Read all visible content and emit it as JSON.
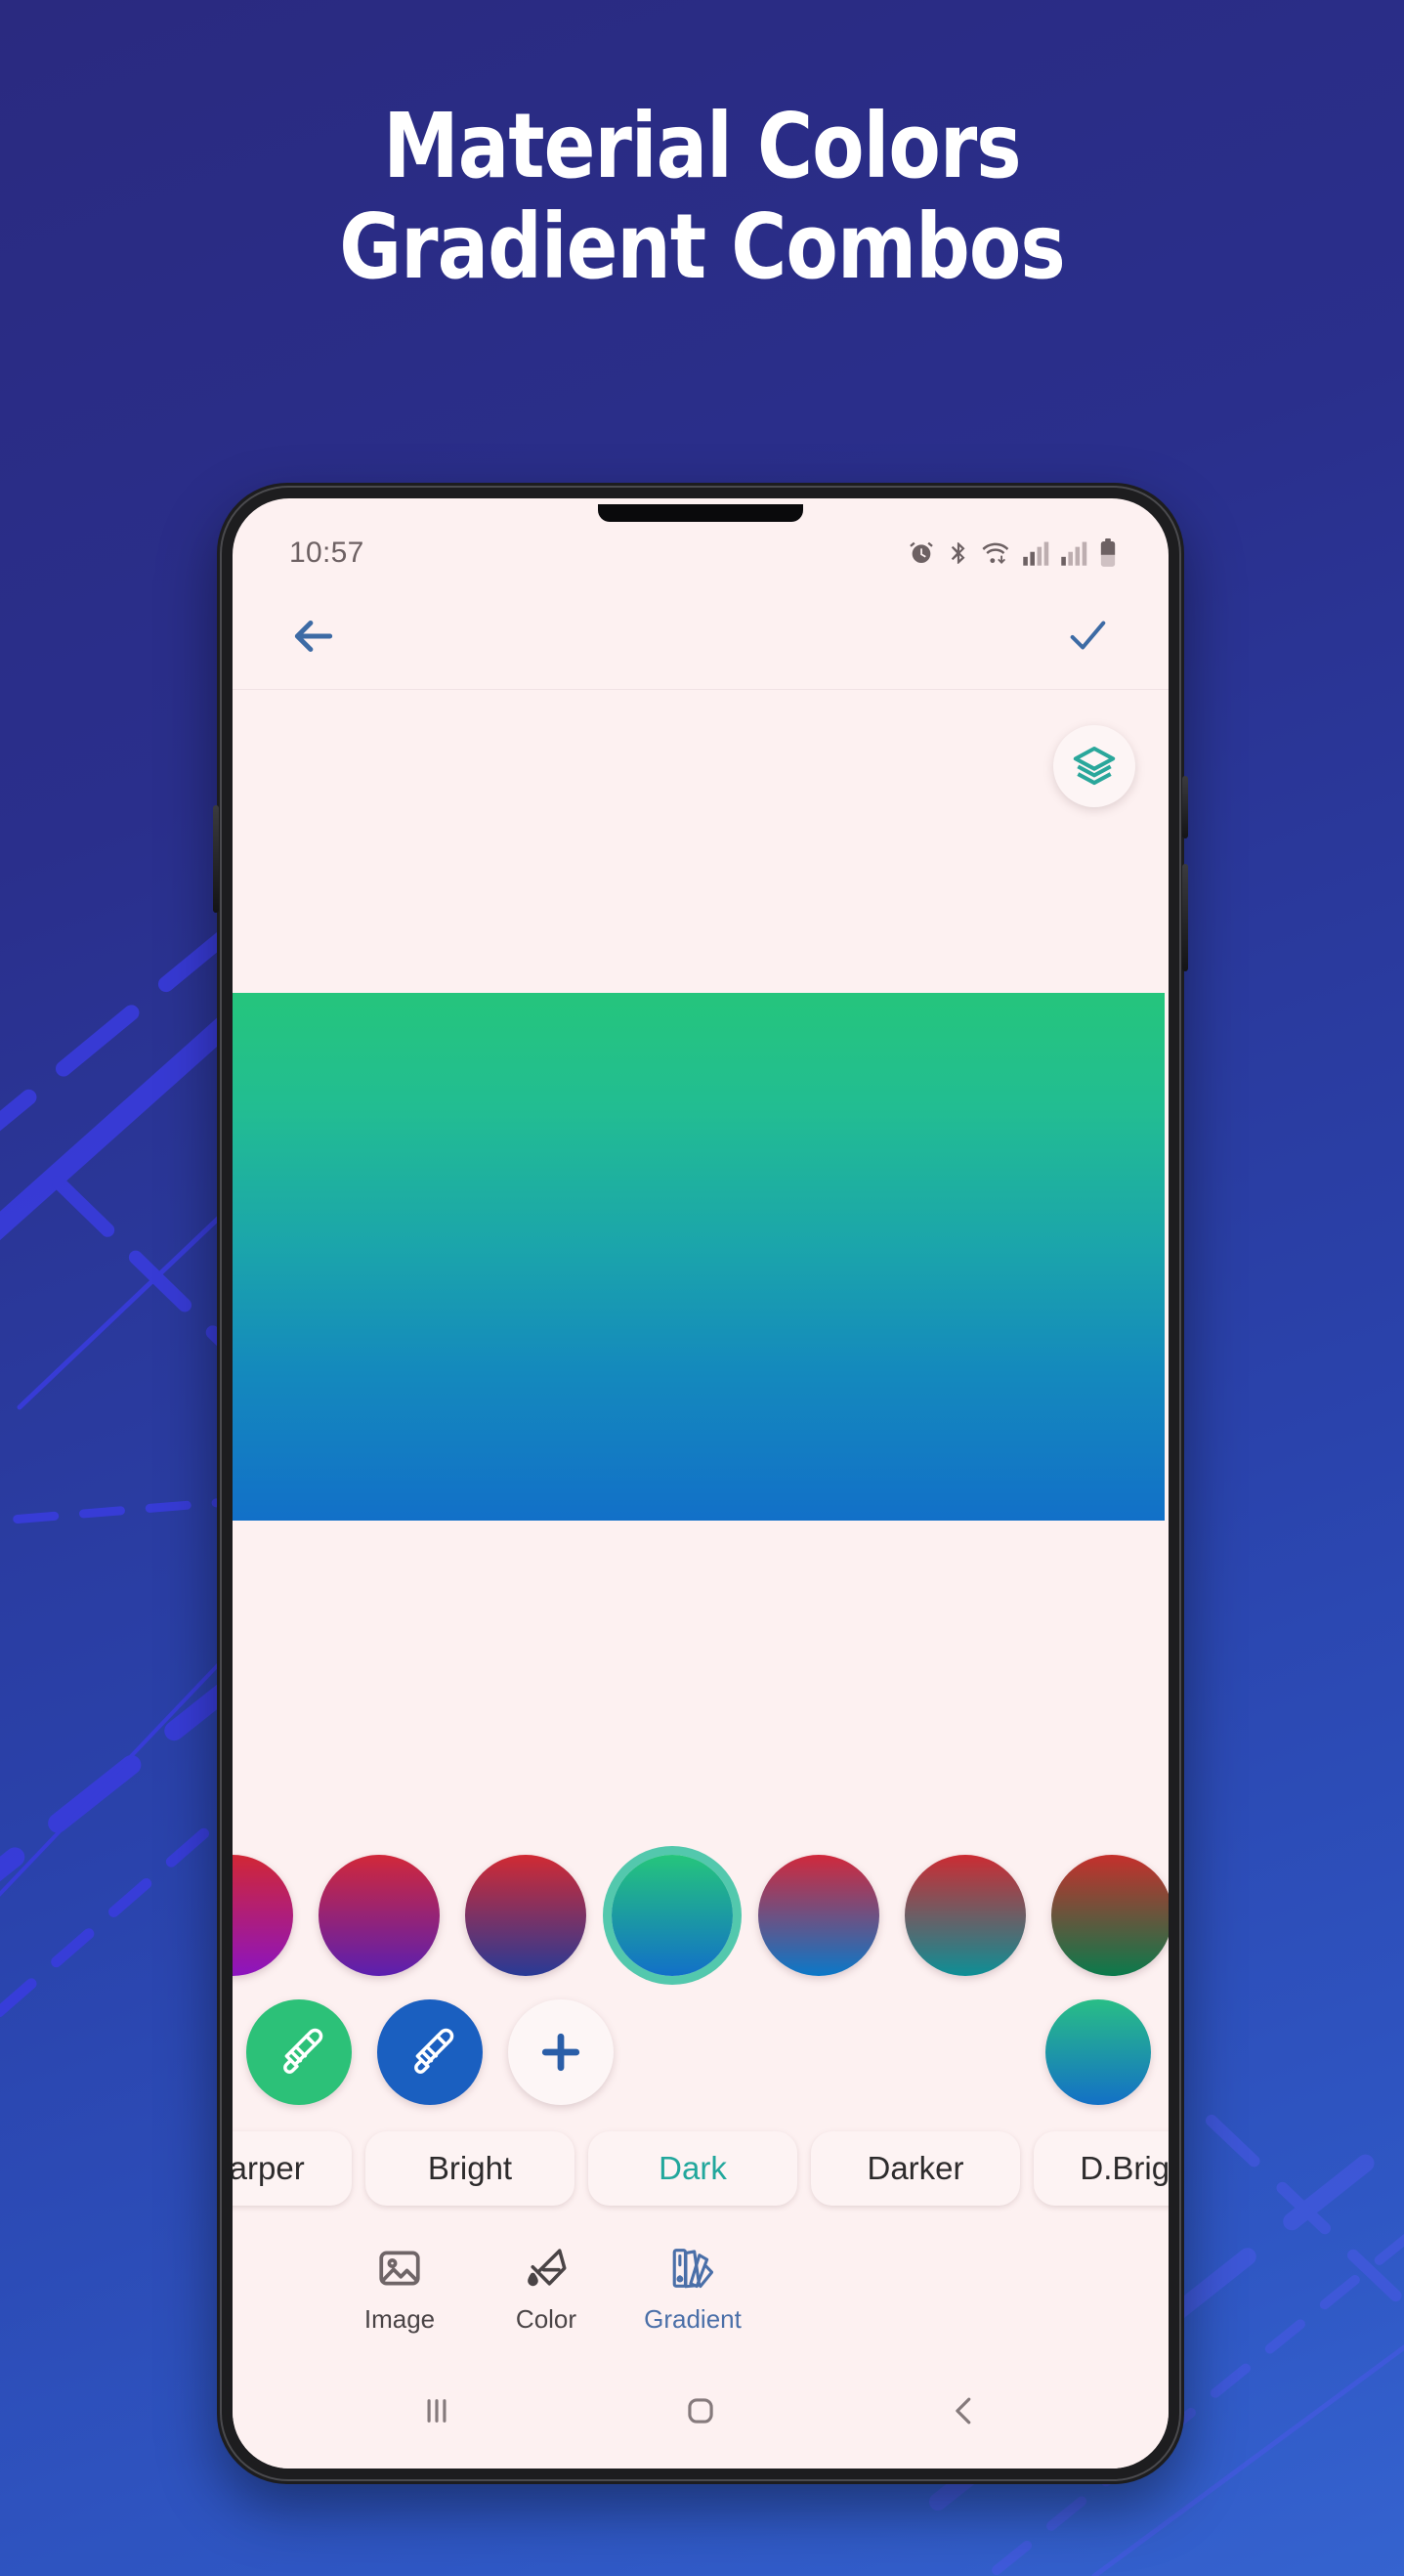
{
  "promo": {
    "headline_line1": "Material Colors",
    "headline_line2": "Gradient Combos",
    "background_color": "#2a2f8c",
    "accent_line_color": "#3a3ce0"
  },
  "phone": {
    "statusbar": {
      "time": "10:57",
      "icons": [
        "alarm-icon",
        "bluetooth-icon",
        "wifi-icon",
        "signal-icon-1",
        "signal-icon-2",
        "battery-icon"
      ]
    },
    "toolbar": {
      "back_label": "back-arrow",
      "confirm_label": "check",
      "icon_color": "#3d6ba5"
    },
    "canvas": {
      "layers_button_label": "layers",
      "layers_icon_color": "#2aa79b",
      "gradient_preview": {
        "start_color": "#25c57c",
        "end_color": "#1270c8"
      }
    },
    "swatches": [
      {
        "name": "red-purple-1",
        "start": "#d12735",
        "end": "#8c14c0"
      },
      {
        "name": "red-purple-2",
        "start": "#d1283a",
        "end": "#5b1fb0"
      },
      {
        "name": "red-navy",
        "start": "#d12a33",
        "end": "#283a96"
      },
      {
        "name": "green-blue",
        "start": "#25c57c",
        "end": "#1270c8",
        "selected": true
      },
      {
        "name": "red-blue",
        "start": "#d1293c",
        "end": "#0b78c8"
      },
      {
        "name": "red-teal",
        "start": "#cc2c33",
        "end": "#0d8f96"
      },
      {
        "name": "red-darkgreen",
        "start": "#c5302c",
        "end": "#0b7a4c"
      }
    ],
    "tools": [
      {
        "name": "eyedropper-start",
        "color": "#2cc178",
        "icon": "eyedropper-icon"
      },
      {
        "name": "eyedropper-end",
        "color": "#1a5fc0",
        "icon": "eyedropper-icon"
      },
      {
        "name": "add-color",
        "color": "#fdf6f6",
        "icon": "plus-icon"
      }
    ],
    "tool_preview": {
      "name": "gradient-preview-circle",
      "start": "#29be86",
      "end": "#1370c6"
    },
    "chips": [
      {
        "label": "Sharper",
        "active": false
      },
      {
        "label": "Bright",
        "active": false
      },
      {
        "label": "Dark",
        "active": true
      },
      {
        "label": "Darker",
        "active": false
      },
      {
        "label": "D.Bright",
        "active": false
      }
    ],
    "chip_active_color": "#22a79c",
    "bottomnav": [
      {
        "label": "Image",
        "icon": "image-icon",
        "active": false
      },
      {
        "label": "Color",
        "icon": "paint-bucket-icon",
        "active": false
      },
      {
        "label": "Gradient",
        "icon": "swatch-fan-icon",
        "active": true
      }
    ],
    "bottomnav_active_color": "#4a6fa8",
    "androidnav": [
      "recents-icon",
      "home-icon",
      "back-icon"
    ]
  }
}
